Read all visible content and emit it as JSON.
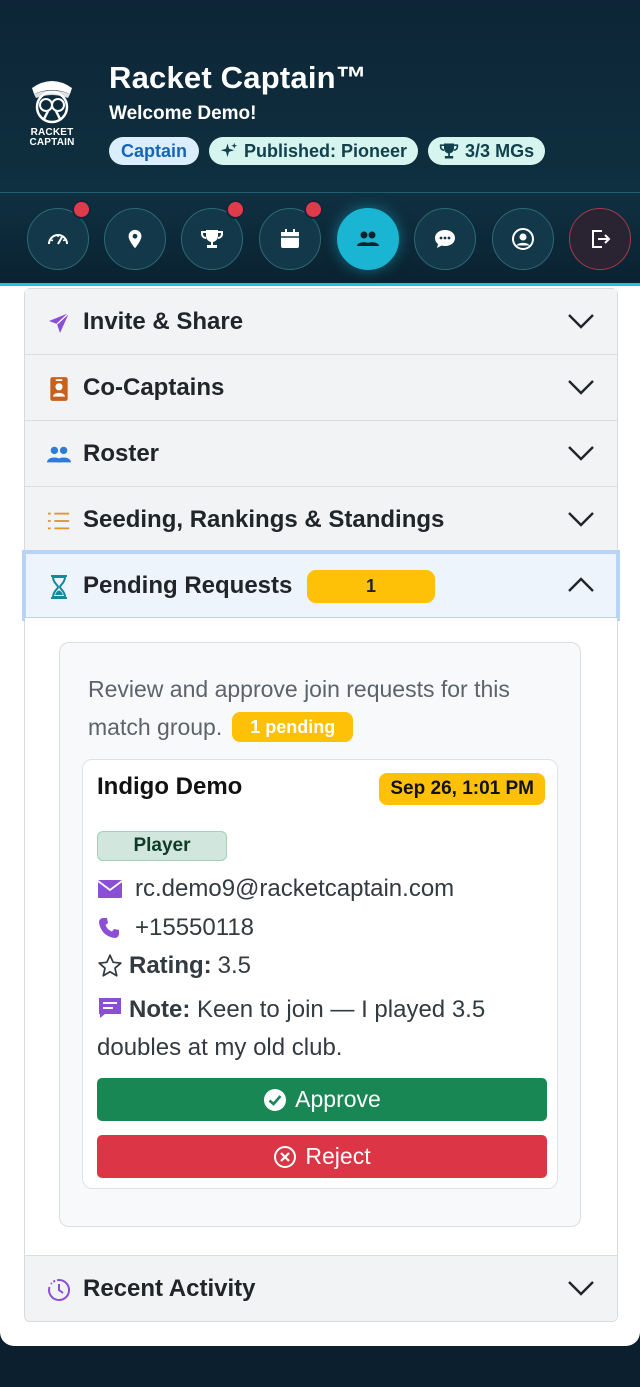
{
  "header": {
    "logo_text_line1": "RACKET",
    "logo_text_line2": "CAPTAIN",
    "title": "Racket Captain™",
    "welcome": "Welcome Demo!",
    "badges": {
      "role": "Captain",
      "published": "Published: Pioneer",
      "mgs": "3/3 MGs"
    }
  },
  "nav": {
    "items": [
      {
        "icon": "dashboard-icon",
        "badge": true
      },
      {
        "icon": "location-pin-icon",
        "badge": false
      },
      {
        "icon": "trophy-icon",
        "badge": true
      },
      {
        "icon": "calendar-icon",
        "badge": true
      },
      {
        "icon": "people-icon",
        "badge": false,
        "active": true
      },
      {
        "icon": "chat-icon",
        "badge": false
      },
      {
        "icon": "profile-icon",
        "badge": false
      },
      {
        "icon": "logout-icon",
        "badge": false
      }
    ]
  },
  "accordion": {
    "invite": "Invite & Share",
    "cocaptains": "Co-Captains",
    "roster": "Roster",
    "seeding": "Seeding, Rankings & Standings",
    "pending": "Pending Requests",
    "pending_count": "1",
    "recent": "Recent Activity"
  },
  "pending_panel": {
    "intro": "Review and approve join requests for this match group.",
    "pending_pill": "1 pending",
    "request": {
      "name": "Indigo Demo",
      "date": "Sep 26, 1:01 PM",
      "role": "Player",
      "email": "rc.demo9@racketcaptain.com",
      "phone": "+15550118",
      "rating_label": "Rating:",
      "rating": "3.5",
      "note_label": "Note:",
      "note": "Keen to join — I played 3.5 doubles at my old club.",
      "approve_label": "Approve",
      "reject_label": "Reject"
    }
  },
  "colors": {
    "header_bg": "#0d2536",
    "accent": "#1ab5d2",
    "warning": "#ffc107",
    "success": "#198754",
    "danger": "#dc3545",
    "notification_dot": "#e03b4a"
  }
}
